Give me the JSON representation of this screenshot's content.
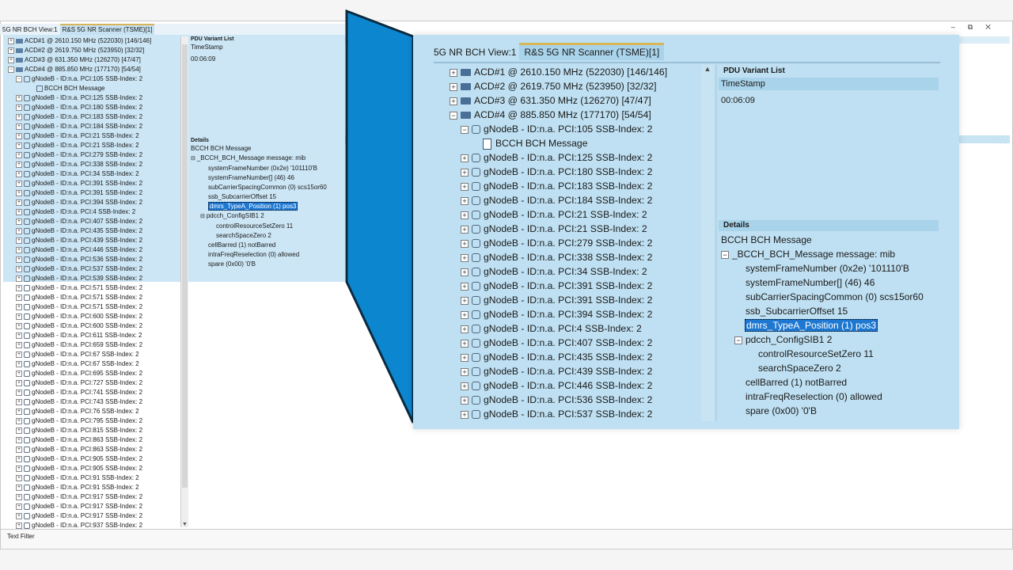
{
  "window": {
    "tabs": [
      {
        "label": "5G NR BCH View:1",
        "selected": false
      },
      {
        "label": "R&S 5G NR Scanner (TSME)[1]",
        "selected": true
      }
    ],
    "controls": [
      "–",
      "⧉",
      "✕"
    ],
    "collapse_label": "<<<"
  },
  "tree": {
    "acd_items": [
      "ACD#1 @ 2610.150 MHz (522030) [146/146]",
      "ACD#2 @ 2619.750 MHz (523950) [32/32]",
      "ACD#3 @ 631.350 MHz (126270) [47/47]",
      "ACD#4 @ 885.850 MHz (177170) [54/54]"
    ],
    "expanded_node": "gNodeB - ID:n.a. PCI:105 SSB-Index: 2",
    "bcch_message": "BCCH BCH Message",
    "gnodeb_small": [
      "gNodeB - ID:n.a. PCI:125 SSB-Index: 2",
      "gNodeB - ID:n.a. PCI:180 SSB-Index: 2",
      "gNodeB - ID:n.a. PCI:183 SSB-Index: 2",
      "gNodeB - ID:n.a. PCI:184 SSB-Index: 2",
      "gNodeB - ID:n.a. PCI:21 SSB-Index: 2",
      "gNodeB - ID:n.a. PCI:21 SSB-Index: 2",
      "gNodeB - ID:n.a. PCI:279 SSB-Index: 2",
      "gNodeB - ID:n.a. PCI:338 SSB-Index: 2",
      "gNodeB - ID:n.a. PCI:34 SSB-Index: 2",
      "gNodeB - ID:n.a. PCI:391 SSB-Index: 2",
      "gNodeB - ID:n.a. PCI:391 SSB-Index: 2",
      "gNodeB - ID:n.a. PCI:394 SSB-Index: 2",
      "gNodeB - ID:n.a. PCI:4 SSB-Index: 2",
      "gNodeB - ID:n.a. PCI:407 SSB-Index: 2",
      "gNodeB - ID:n.a. PCI:435 SSB-Index: 2",
      "gNodeB - ID:n.a. PCI:439 SSB-Index: 2",
      "gNodeB - ID:n.a. PCI:446 SSB-Index: 2",
      "gNodeB - ID:n.a. PCI:536 SSB-Index: 2",
      "gNodeB - ID:n.a. PCI:537 SSB-Index: 2",
      "gNodeB - ID:n.a. PCI:539 SSB-Index: 2",
      "gNodeB - ID:n.a. PCI:571 SSB-Index: 2",
      "gNodeB - ID:n.a. PCI:571 SSB-Index: 2",
      "gNodeB - ID:n.a. PCI:571 SSB-Index: 2",
      "gNodeB - ID:n.a. PCI:600 SSB-Index: 2",
      "gNodeB - ID:n.a. PCI:600 SSB-Index: 2",
      "gNodeB - ID:n.a. PCI:611 SSB-Index: 2",
      "gNodeB - ID:n.a. PCI:659 SSB-Index: 2",
      "gNodeB - ID:n.a. PCI:67 SSB-Index: 2",
      "gNodeB - ID:n.a. PCI:67 SSB-Index: 2",
      "gNodeB - ID:n.a. PCI:695 SSB-Index: 2",
      "gNodeB - ID:n.a. PCI:727 SSB-Index: 2",
      "gNodeB - ID:n.a. PCI:741 SSB-Index: 2",
      "gNodeB - ID:n.a. PCI:743 SSB-Index: 2",
      "gNodeB - ID:n.a. PCI:76 SSB-Index: 2",
      "gNodeB - ID:n.a. PCI:795 SSB-Index: 2",
      "gNodeB - ID:n.a. PCI:815 SSB-Index: 2",
      "gNodeB - ID:n.a. PCI:863 SSB-Index: 2",
      "gNodeB - ID:n.a. PCI:863 SSB-Index: 2",
      "gNodeB - ID:n.a. PCI:905 SSB-Index: 2",
      "gNodeB - ID:n.a. PCI:905 SSB-Index: 2",
      "gNodeB - ID:n.a. PCI:91 SSB-Index: 2",
      "gNodeB - ID:n.a. PCI:91 SSB-Index: 2",
      "gNodeB - ID:n.a. PCI:917 SSB-Index: 2",
      "gNodeB - ID:n.a. PCI:917 SSB-Index: 2",
      "gNodeB - ID:n.a. PCI:917 SSB-Index: 2",
      "gNodeB - ID:n.a. PCI:937 SSB-Index: 2"
    ],
    "gnodeb_zoom": [
      "gNodeB - ID:n.a. PCI:125 SSB-Index: 2",
      "gNodeB - ID:n.a. PCI:180 SSB-Index: 2",
      "gNodeB - ID:n.a. PCI:183 SSB-Index: 2",
      "gNodeB - ID:n.a. PCI:184 SSB-Index: 2",
      "gNodeB - ID:n.a. PCI:21 SSB-Index: 2",
      "gNodeB - ID:n.a. PCI:21 SSB-Index: 2",
      "gNodeB - ID:n.a. PCI:279 SSB-Index: 2",
      "gNodeB - ID:n.a. PCI:338 SSB-Index: 2",
      "gNodeB - ID:n.a. PCI:34 SSB-Index: 2",
      "gNodeB - ID:n.a. PCI:391 SSB-Index: 2",
      "gNodeB - ID:n.a. PCI:391 SSB-Index: 2",
      "gNodeB - ID:n.a. PCI:394 SSB-Index: 2",
      "gNodeB - ID:n.a. PCI:4 SSB-Index: 2",
      "gNodeB - ID:n.a. PCI:407 SSB-Index: 2",
      "gNodeB - ID:n.a. PCI:435 SSB-Index: 2",
      "gNodeB - ID:n.a. PCI:439 SSB-Index: 2",
      "gNodeB - ID:n.a. PCI:446 SSB-Index: 2",
      "gNodeB - ID:n.a. PCI:536 SSB-Index: 2",
      "gNodeB - ID:n.a. PCI:537 SSB-Index: 2"
    ]
  },
  "pdu": {
    "title": "PDU Variant List",
    "column": "TimeStamp",
    "value": "00:06:09"
  },
  "details": {
    "title": "Details",
    "message_title": "BCCH BCH Message",
    "root": "_BCCH_BCH_Message message: mib",
    "fields": [
      "systemFrameNumber  (0x2e)   '101110'B",
      "systemFrameNumber[]  (46)  46",
      "subCarrierSpacingCommon  (0)  scs15or60",
      "ssb_SubcarrierOffset  15"
    ],
    "selected_field": "dmrs_TypeA_Position  (1)  pos3",
    "pdcch": "pdcch_ConfigSIB1  2",
    "pdcch_children": [
      "controlResourceSetZero  11",
      "searchSpaceZero  2"
    ],
    "tail_fields": [
      "cellBarred  (1)  notBarred",
      "intraFreqReselection  (0)  allowed",
      "spare  (0x00)  '0'B"
    ]
  },
  "footer": {
    "text_filter": "Text Filter"
  },
  "colors": {
    "highlight": "#bfe0f2",
    "zoom_wedge": "#0d86d0",
    "tab_accent": "#d9b55a",
    "selection": "#1e78d2"
  }
}
